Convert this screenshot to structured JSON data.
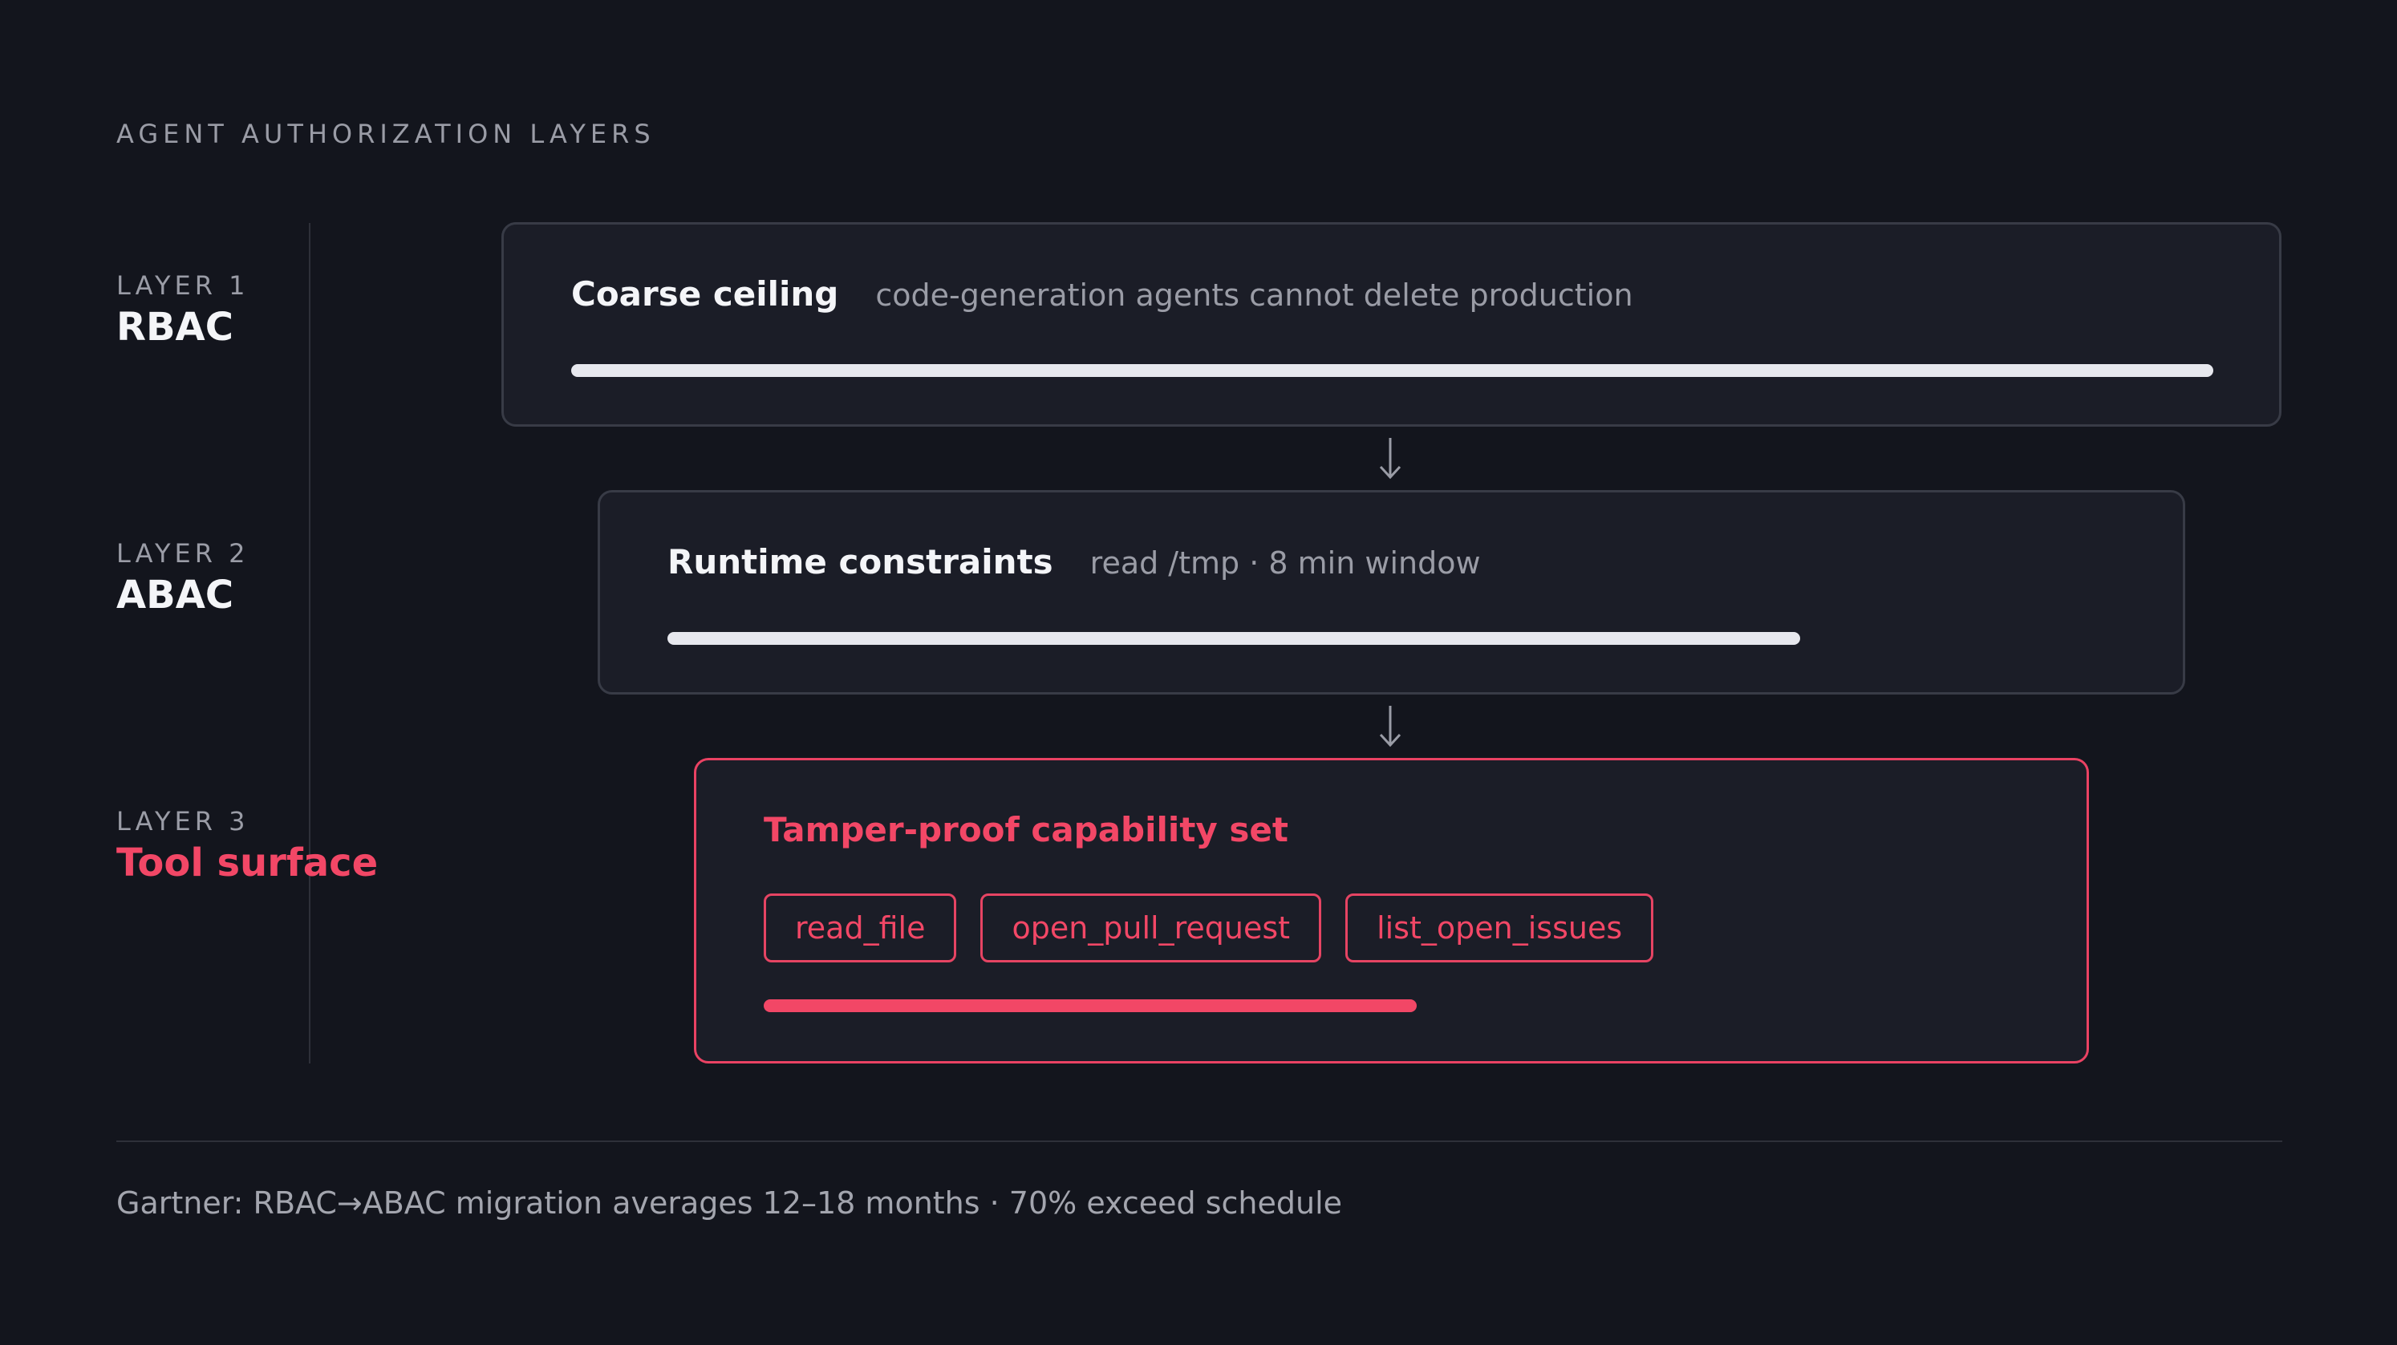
{
  "title": "AGENT AUTHORIZATION LAYERS",
  "layers": [
    {
      "kicker": "LAYER 1",
      "name": "RBAC",
      "card_title": "Coarse ceiling",
      "card_subtitle": "code-generation agents cannot delete production",
      "scope_fraction": 1.0
    },
    {
      "kicker": "LAYER 2",
      "name": "ABAC",
      "card_title": "Runtime constraints",
      "card_subtitle": "read /tmp · 8 min window",
      "scope_fraction": 0.69
    },
    {
      "kicker": "LAYER 3",
      "name": "Tool surface",
      "card_title": "Tamper-proof capability set",
      "tools": [
        "read_file",
        "open_pull_request",
        "list_open_issues"
      ],
      "scope_fraction": 0.5
    }
  ],
  "footnote": "Gartner: RBAC→ABAC migration averages 12–18 months · 70% exceed schedule",
  "colors": {
    "background": "#13151d",
    "card": "#1b1d27",
    "border": "#383b46",
    "accent": "#f24766",
    "bar": "#e7e8ee",
    "muted": "#9a9ca6"
  },
  "icons": {
    "flow_arrow": "arrow-down-icon"
  }
}
